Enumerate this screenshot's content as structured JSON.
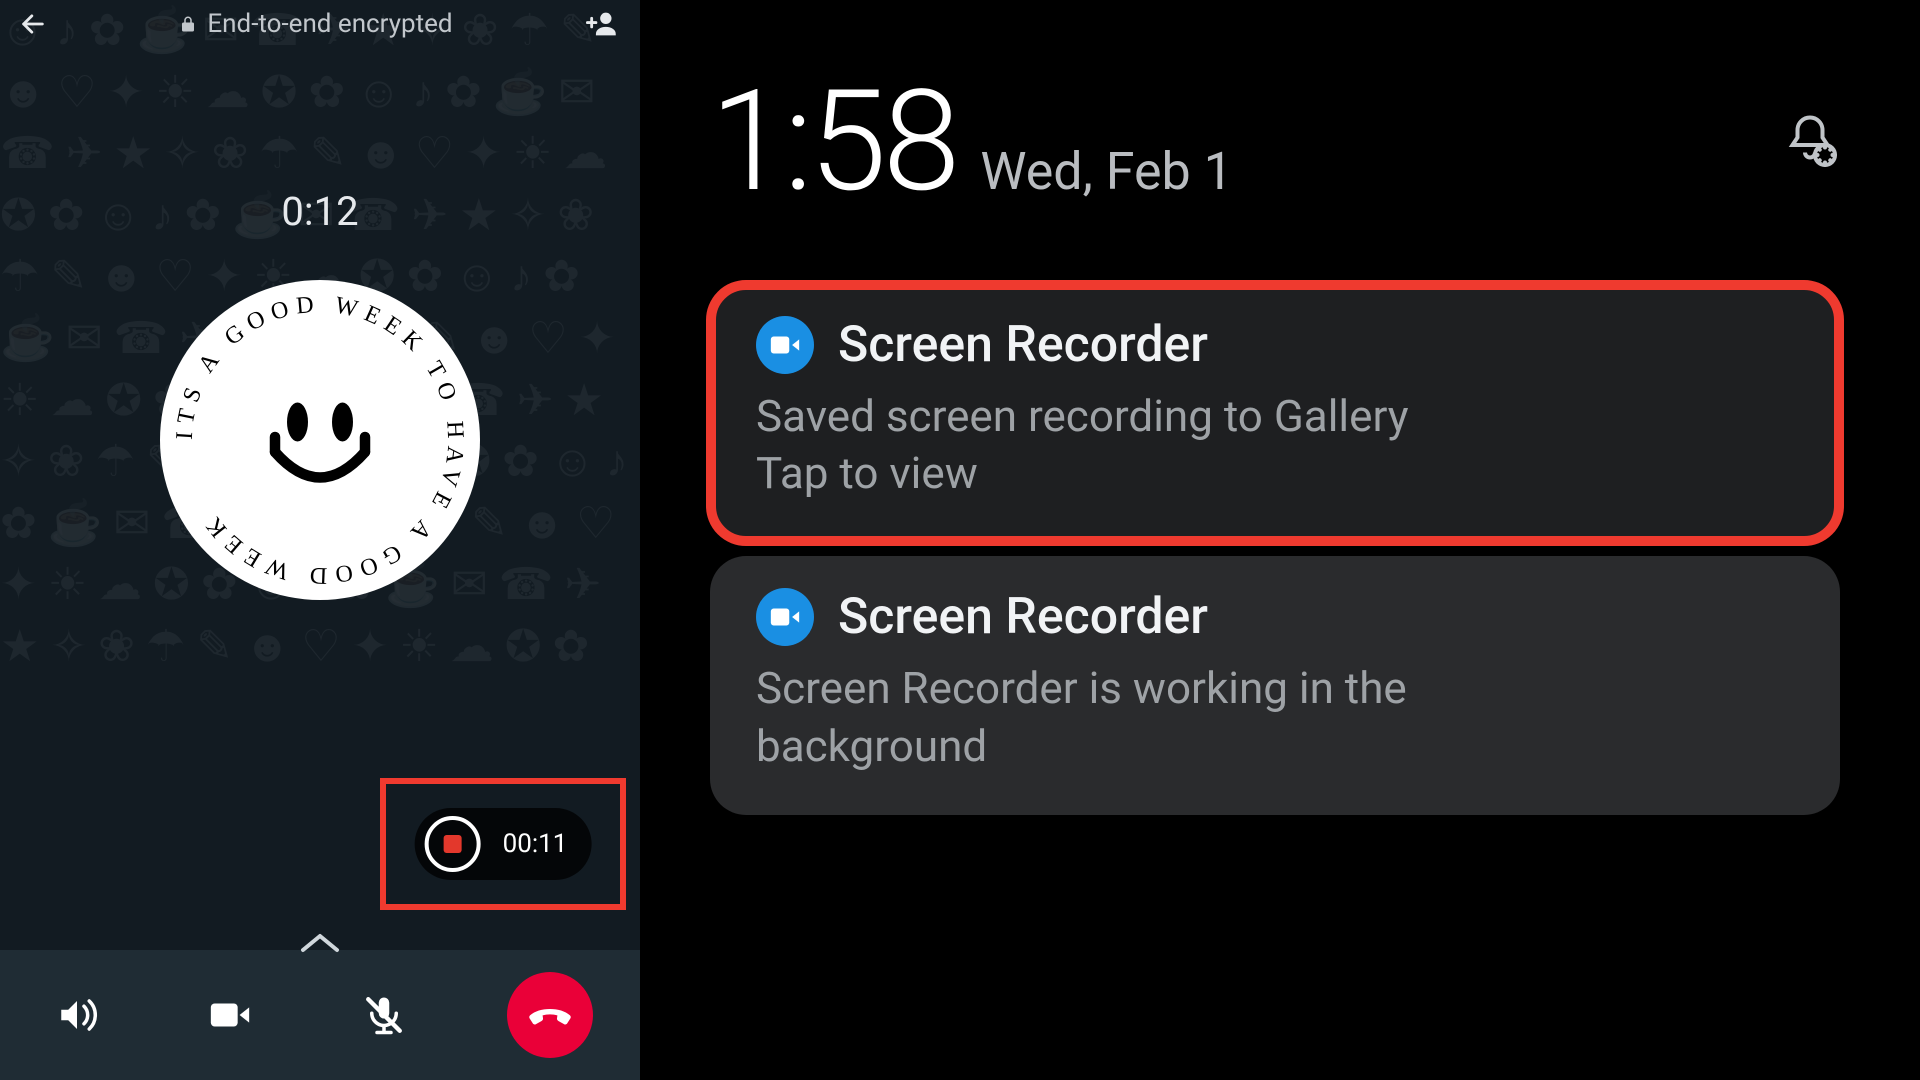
{
  "left": {
    "encryption_label": "End-to-end encrypted",
    "call_timer": "0:12",
    "avatar_ring_text": "ITS A GOOD WEEK TO HAVE A GOOD WEEK ",
    "recording_timer": "00:11"
  },
  "right": {
    "clock": "1:58",
    "date": "Wed, Feb 1",
    "notifications": [
      {
        "app": "Screen Recorder",
        "body_line1": "Saved screen recording to Gallery",
        "body_line2": "Tap to view",
        "highlighted": true
      },
      {
        "app": "Screen Recorder",
        "body_line1": "Screen Recorder is working in the",
        "body_line2": "background",
        "highlighted": false
      }
    ]
  }
}
